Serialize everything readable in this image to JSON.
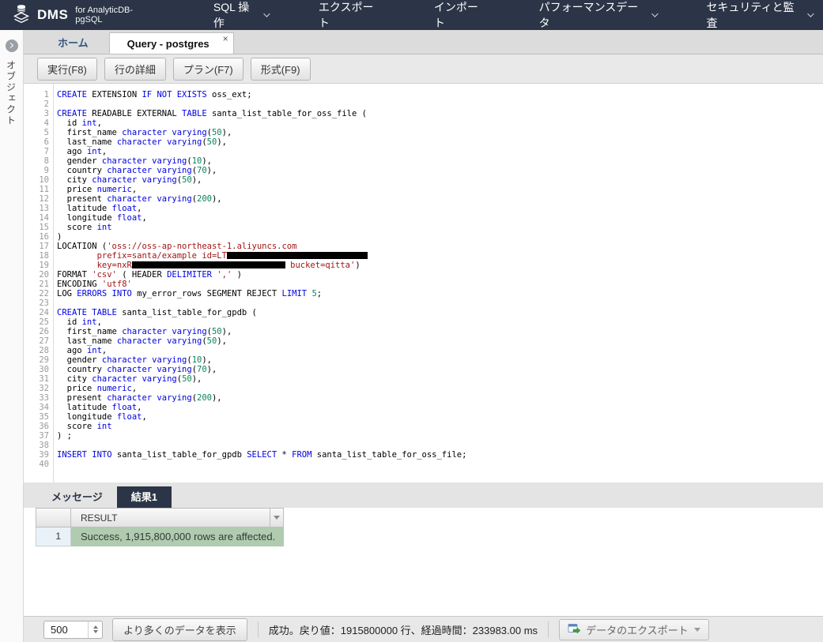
{
  "topnav": {
    "brand": "DMS",
    "brand_suffix": "for AnalyticDB-pgSQL",
    "items": [
      {
        "label": "SQL 操作",
        "caret": true
      },
      {
        "label": "エクスポート",
        "caret": false
      },
      {
        "label": "インポート",
        "caret": false
      },
      {
        "label": "パフォーマンスデータ",
        "caret": true
      },
      {
        "label": "セキュリティと監査",
        "caret": true
      }
    ]
  },
  "sidebar": {
    "label": "オブジェクト"
  },
  "tabs": [
    {
      "label": "ホーム"
    },
    {
      "label": "Query - postgres",
      "close": "×"
    }
  ],
  "toolbar": {
    "buttons": [
      "実行(F8)",
      "行の詳細",
      "プラン(F7)",
      "形式(F9)"
    ]
  },
  "editor": {
    "lines": [
      [
        {
          "c": "k",
          "t": "CREATE"
        },
        {
          "c": "p",
          "t": " EXTENSION "
        },
        {
          "c": "k",
          "t": "IF NOT EXISTS"
        },
        {
          "c": "p",
          "t": " oss_ext;"
        }
      ],
      [],
      [
        {
          "c": "k",
          "t": "CREATE"
        },
        {
          "c": "p",
          "t": " READABLE EXTERNAL "
        },
        {
          "c": "k",
          "t": "TABLE"
        },
        {
          "c": "p",
          "t": " santa_list_table_for_oss_file ("
        }
      ],
      [
        {
          "c": "p",
          "t": "  id "
        },
        {
          "c": "k",
          "t": "int"
        },
        {
          "c": "p",
          "t": ","
        }
      ],
      [
        {
          "c": "p",
          "t": "  first_name "
        },
        {
          "c": "k",
          "t": "character varying"
        },
        {
          "c": "p",
          "t": "("
        },
        {
          "c": "n",
          "t": "50"
        },
        {
          "c": "p",
          "t": "),"
        }
      ],
      [
        {
          "c": "p",
          "t": "  last_name "
        },
        {
          "c": "k",
          "t": "character varying"
        },
        {
          "c": "p",
          "t": "("
        },
        {
          "c": "n",
          "t": "50"
        },
        {
          "c": "p",
          "t": "),"
        }
      ],
      [
        {
          "c": "p",
          "t": "  ago "
        },
        {
          "c": "k",
          "t": "int"
        },
        {
          "c": "p",
          "t": ","
        }
      ],
      [
        {
          "c": "p",
          "t": "  gender "
        },
        {
          "c": "k",
          "t": "character varying"
        },
        {
          "c": "p",
          "t": "("
        },
        {
          "c": "n",
          "t": "10"
        },
        {
          "c": "p",
          "t": "),"
        }
      ],
      [
        {
          "c": "p",
          "t": "  country "
        },
        {
          "c": "k",
          "t": "character varying"
        },
        {
          "c": "p",
          "t": "("
        },
        {
          "c": "n",
          "t": "70"
        },
        {
          "c": "p",
          "t": "),"
        }
      ],
      [
        {
          "c": "p",
          "t": "  city "
        },
        {
          "c": "k",
          "t": "character varying"
        },
        {
          "c": "p",
          "t": "("
        },
        {
          "c": "n",
          "t": "50"
        },
        {
          "c": "p",
          "t": "),"
        }
      ],
      [
        {
          "c": "p",
          "t": "  price "
        },
        {
          "c": "k",
          "t": "numeric"
        },
        {
          "c": "p",
          "t": ","
        }
      ],
      [
        {
          "c": "p",
          "t": "  present "
        },
        {
          "c": "k",
          "t": "character varying"
        },
        {
          "c": "p",
          "t": "("
        },
        {
          "c": "n",
          "t": "200"
        },
        {
          "c": "p",
          "t": "),"
        }
      ],
      [
        {
          "c": "p",
          "t": "  latitude "
        },
        {
          "c": "k",
          "t": "float"
        },
        {
          "c": "p",
          "t": ","
        }
      ],
      [
        {
          "c": "p",
          "t": "  longitude "
        },
        {
          "c": "k",
          "t": "float"
        },
        {
          "c": "p",
          "t": ","
        }
      ],
      [
        {
          "c": "p",
          "t": "  score "
        },
        {
          "c": "k",
          "t": "int"
        }
      ],
      [
        {
          "c": "p",
          "t": ")"
        }
      ],
      [
        {
          "c": "p",
          "t": "LOCATION ("
        },
        {
          "c": "s",
          "t": "'oss://oss-ap-northeast-1.aliyuncs.com"
        }
      ],
      [
        {
          "c": "s",
          "t": "        prefix=santa/example id=LT"
        },
        {
          "c": "r",
          "w": 178
        }
      ],
      [
        {
          "c": "s",
          "t": "        key=nxR"
        },
        {
          "c": "r",
          "w": 194
        },
        {
          "c": "s",
          "t": " bucket=qitta'"
        },
        {
          "c": "p",
          "t": ")"
        }
      ],
      [
        {
          "c": "p",
          "t": "FORMAT "
        },
        {
          "c": "s",
          "t": "'csv'"
        },
        {
          "c": "p",
          "t": " ( HEADER "
        },
        {
          "c": "k",
          "t": "DELIMITER"
        },
        {
          "c": "p",
          "t": " "
        },
        {
          "c": "s",
          "t": "','"
        },
        {
          "c": "p",
          "t": " )"
        }
      ],
      [
        {
          "c": "p",
          "t": "ENCODING "
        },
        {
          "c": "s",
          "t": "'utf8'"
        }
      ],
      [
        {
          "c": "p",
          "t": "LOG "
        },
        {
          "c": "k",
          "t": "ERRORS INTO"
        },
        {
          "c": "p",
          "t": " my_error_rows SEGMENT REJECT "
        },
        {
          "c": "k",
          "t": "LIMIT"
        },
        {
          "c": "p",
          "t": " "
        },
        {
          "c": "n",
          "t": "5"
        },
        {
          "c": "p",
          "t": ";"
        }
      ],
      [],
      [
        {
          "c": "k",
          "t": "CREATE TABLE"
        },
        {
          "c": "p",
          "t": " santa_list_table_for_gpdb ("
        }
      ],
      [
        {
          "c": "p",
          "t": "  id "
        },
        {
          "c": "k",
          "t": "int"
        },
        {
          "c": "p",
          "t": ","
        }
      ],
      [
        {
          "c": "p",
          "t": "  first_name "
        },
        {
          "c": "k",
          "t": "character varying"
        },
        {
          "c": "p",
          "t": "("
        },
        {
          "c": "n",
          "t": "50"
        },
        {
          "c": "p",
          "t": "),"
        }
      ],
      [
        {
          "c": "p",
          "t": "  last_name "
        },
        {
          "c": "k",
          "t": "character varying"
        },
        {
          "c": "p",
          "t": "("
        },
        {
          "c": "n",
          "t": "50"
        },
        {
          "c": "p",
          "t": "),"
        }
      ],
      [
        {
          "c": "p",
          "t": "  ago "
        },
        {
          "c": "k",
          "t": "int"
        },
        {
          "c": "p",
          "t": ","
        }
      ],
      [
        {
          "c": "p",
          "t": "  gender "
        },
        {
          "c": "k",
          "t": "character varying"
        },
        {
          "c": "p",
          "t": "("
        },
        {
          "c": "n",
          "t": "10"
        },
        {
          "c": "p",
          "t": "),"
        }
      ],
      [
        {
          "c": "p",
          "t": "  country "
        },
        {
          "c": "k",
          "t": "character varying"
        },
        {
          "c": "p",
          "t": "("
        },
        {
          "c": "n",
          "t": "70"
        },
        {
          "c": "p",
          "t": "),"
        }
      ],
      [
        {
          "c": "p",
          "t": "  city "
        },
        {
          "c": "k",
          "t": "character varying"
        },
        {
          "c": "p",
          "t": "("
        },
        {
          "c": "n",
          "t": "50"
        },
        {
          "c": "p",
          "t": "),"
        }
      ],
      [
        {
          "c": "p",
          "t": "  price "
        },
        {
          "c": "k",
          "t": "numeric"
        },
        {
          "c": "p",
          "t": ","
        }
      ],
      [
        {
          "c": "p",
          "t": "  present "
        },
        {
          "c": "k",
          "t": "character varying"
        },
        {
          "c": "p",
          "t": "("
        },
        {
          "c": "n",
          "t": "200"
        },
        {
          "c": "p",
          "t": "),"
        }
      ],
      [
        {
          "c": "p",
          "t": "  latitude "
        },
        {
          "c": "k",
          "t": "float"
        },
        {
          "c": "p",
          "t": ","
        }
      ],
      [
        {
          "c": "p",
          "t": "  longitude "
        },
        {
          "c": "k",
          "t": "float"
        },
        {
          "c": "p",
          "t": ","
        }
      ],
      [
        {
          "c": "p",
          "t": "  score "
        },
        {
          "c": "k",
          "t": "int"
        }
      ],
      [
        {
          "c": "p",
          "t": ") ;"
        }
      ],
      [],
      [
        {
          "c": "k",
          "t": "INSERT INTO"
        },
        {
          "c": "p",
          "t": " santa_list_table_for_gpdb "
        },
        {
          "c": "k",
          "t": "SELECT"
        },
        {
          "c": "p",
          "t": " * "
        },
        {
          "c": "k",
          "t": "FROM"
        },
        {
          "c": "p",
          "t": " santa_list_table_for_oss_file;"
        }
      ],
      []
    ]
  },
  "results": {
    "tabs": [
      {
        "label": "メッセージ"
      },
      {
        "label": "結果1"
      }
    ],
    "columns": [
      "RESULT"
    ],
    "rows": [
      {
        "num": "1",
        "result": "Success, 1,915,800,000 rows are affected."
      }
    ]
  },
  "statusbar": {
    "page_size": "500",
    "more_label": "より多くのデータを表示",
    "status": "成功。戻り値：1915800000 行、経過時間：233983.00 ms",
    "export_label": "データのエクスポート"
  },
  "colors": {
    "topnav_bg": "#2b3547",
    "active_result_tab_bg": "#2b3547",
    "success_cell_bg": "#b0cbb0",
    "rownum_cell_bg": "#e9f2f9",
    "keyword": "#0000e0",
    "number": "#098658",
    "string": "#a31515",
    "redaction": "#000000"
  }
}
